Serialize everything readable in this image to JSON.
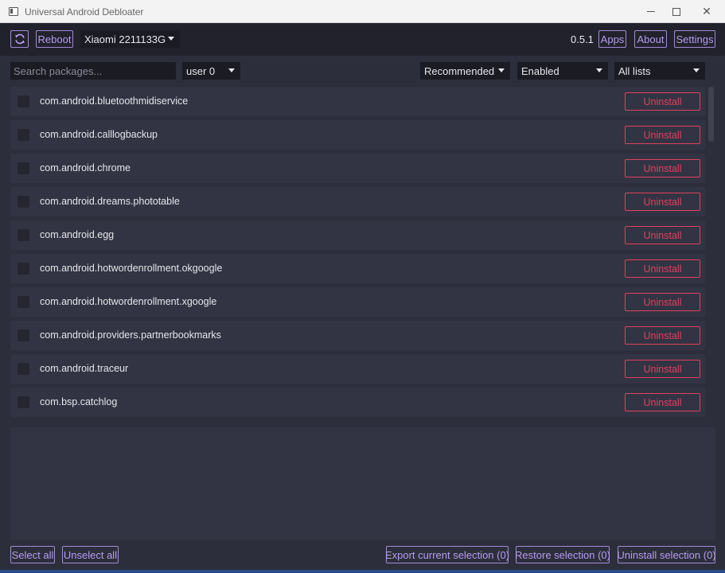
{
  "window": {
    "title": "Universal Android Debloater",
    "minimize_glyph": "",
    "maximize_glyph": "",
    "close_glyph": "✕"
  },
  "header": {
    "refresh_icon": "refresh-icon",
    "reboot_label": "Reboot",
    "device": "Xiaomi 2211133G",
    "version": "0.5.1",
    "apps_label": "Apps",
    "about_label": "About",
    "settings_label": "Settings"
  },
  "filters": {
    "search_placeholder": "Search packages...",
    "search_value": "",
    "user": "user 0",
    "recommendation": "Recommended",
    "state": "Enabled",
    "list": "All lists"
  },
  "packages": [
    {
      "name": "com.android.bluetoothmidiservice",
      "action": "Uninstall",
      "checked": false
    },
    {
      "name": "com.android.calllogbackup",
      "action": "Uninstall",
      "checked": false
    },
    {
      "name": "com.android.chrome",
      "action": "Uninstall",
      "checked": false
    },
    {
      "name": "com.android.dreams.phototable",
      "action": "Uninstall",
      "checked": false
    },
    {
      "name": "com.android.egg",
      "action": "Uninstall",
      "checked": false
    },
    {
      "name": "com.android.hotwordenrollment.okgoogle",
      "action": "Uninstall",
      "checked": false
    },
    {
      "name": "com.android.hotwordenrollment.xgoogle",
      "action": "Uninstall",
      "checked": false
    },
    {
      "name": "com.android.providers.partnerbookmarks",
      "action": "Uninstall",
      "checked": false
    },
    {
      "name": "com.android.traceur",
      "action": "Uninstall",
      "checked": false
    },
    {
      "name": "com.bsp.catchlog",
      "action": "Uninstall",
      "checked": false
    }
  ],
  "description": "",
  "footer": {
    "select_all": "Select all",
    "unselect_all": "Unselect all",
    "export": "Export current selection (0)",
    "restore": "Restore selection (0)",
    "uninstall_selection": "Uninstall selection (0)"
  },
  "colors": {
    "background": "#2c2e3b",
    "header": "#21222c",
    "accent": "#b79cf0",
    "danger": "#e0405f",
    "row": "#323443"
  }
}
